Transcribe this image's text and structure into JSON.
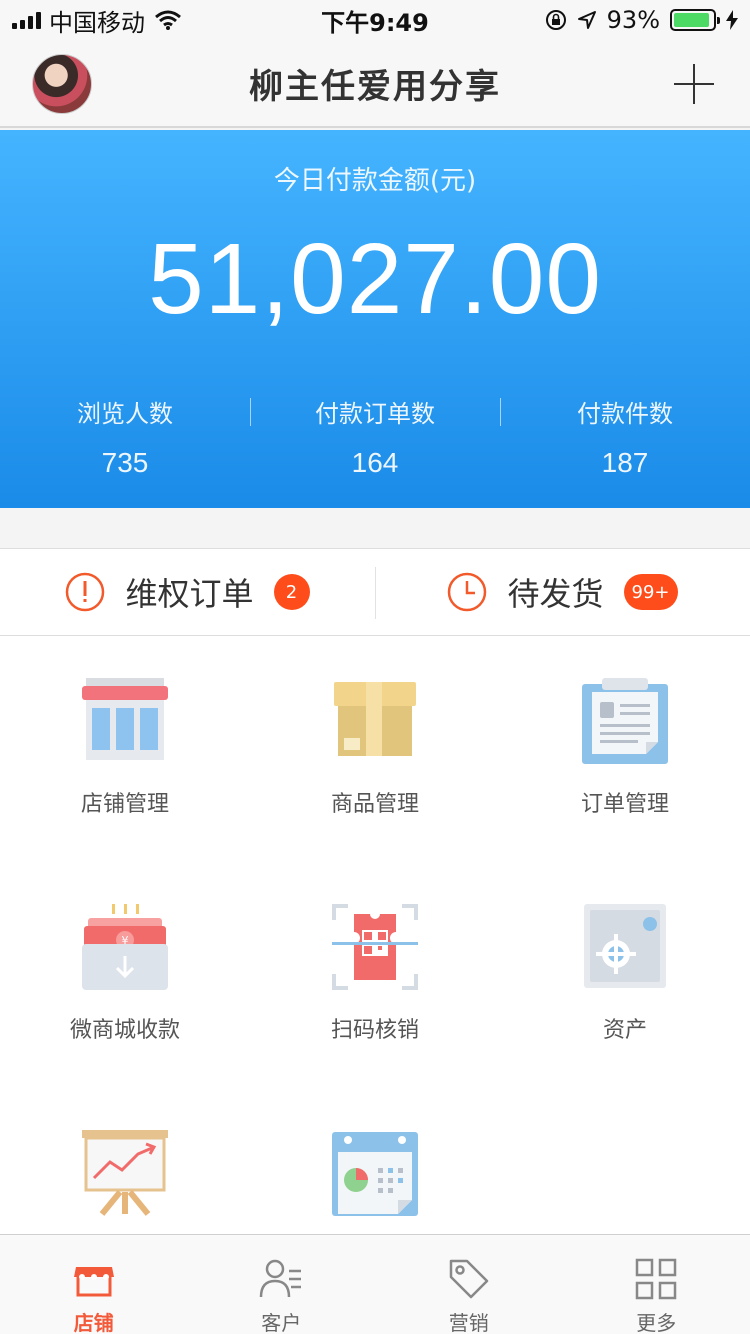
{
  "status_bar": {
    "carrier": "中国移动",
    "time": "下午9:49",
    "battery_pct": "93%"
  },
  "header": {
    "title": "柳主任爱用分享"
  },
  "summary": {
    "label": "今日付款金额(元)",
    "amount": "51,027.00",
    "stats": [
      {
        "label": "浏览人数",
        "value": "735"
      },
      {
        "label": "付款订单数",
        "value": "164"
      },
      {
        "label": "付款件数",
        "value": "187"
      }
    ]
  },
  "quick": {
    "rights": {
      "label": "维权订单",
      "badge": "2"
    },
    "pending": {
      "label": "待发货",
      "badge": "99+"
    }
  },
  "grid": [
    {
      "label": "店铺管理",
      "icon": "storefront-icon"
    },
    {
      "label": "商品管理",
      "icon": "package-icon"
    },
    {
      "label": "订单管理",
      "icon": "clipboard-icon"
    },
    {
      "label": "微商城收款",
      "icon": "cash-receive-icon"
    },
    {
      "label": "扫码核销",
      "icon": "qr-ticket-icon"
    },
    {
      "label": "资产",
      "icon": "safe-icon"
    },
    {
      "label": "",
      "icon": "growth-chart-icon"
    },
    {
      "label": "",
      "icon": "calendar-chart-icon"
    }
  ],
  "tabs": [
    {
      "label": "店铺",
      "active": true
    },
    {
      "label": "客户"
    },
    {
      "label": "营销"
    },
    {
      "label": "更多"
    }
  ],
  "colors": {
    "accent": "#f25a3a",
    "badge": "#fe4d1a",
    "summary_top": "#45b4ff",
    "summary_bottom": "#1a8be8"
  }
}
